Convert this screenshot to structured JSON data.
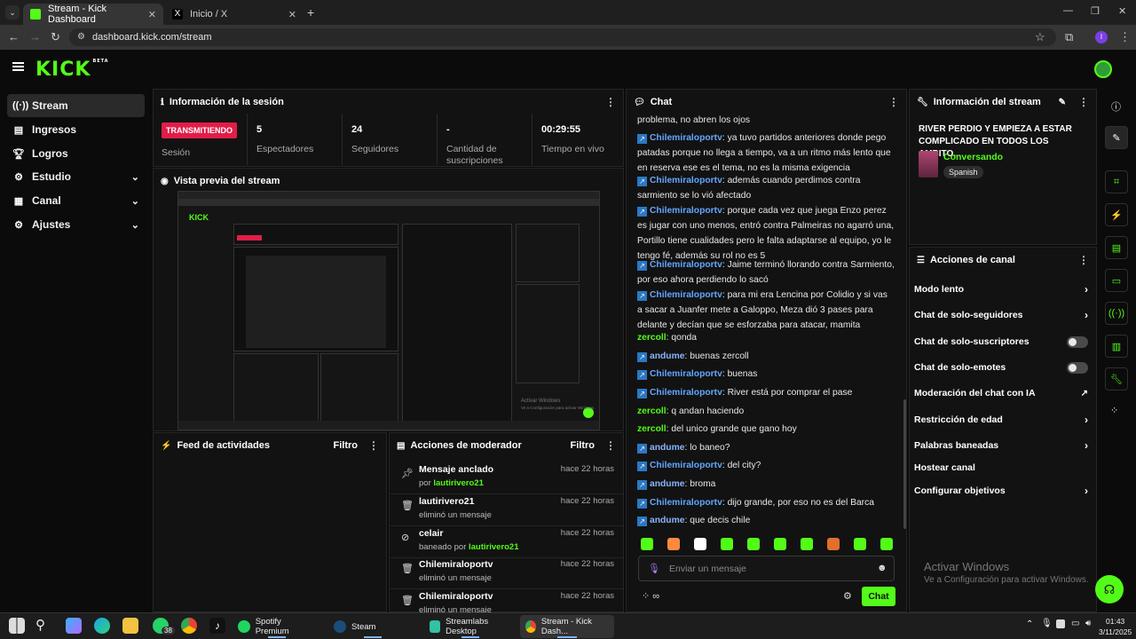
{
  "browser": {
    "tabs": [
      {
        "title": "Stream - Kick Dashboard",
        "active": true
      },
      {
        "title": "Inicio / X",
        "active": false
      }
    ],
    "url": "dashboard.kick.com/stream"
  },
  "logo": "KICK",
  "logo_badge": "BETA",
  "sidebar": {
    "items": [
      {
        "label": "Stream",
        "icon": "broadcast-icon",
        "active": true,
        "expand": false
      },
      {
        "label": "Ingresos",
        "icon": "money-icon",
        "expand": false
      },
      {
        "label": "Logros",
        "icon": "trophy-icon",
        "expand": false
      },
      {
        "label": "Estudio",
        "icon": "studio-icon",
        "expand": true
      },
      {
        "label": "Canal",
        "icon": "channel-icon",
        "expand": true
      },
      {
        "label": "Ajustes",
        "icon": "gear-icon",
        "expand": true
      }
    ]
  },
  "session": {
    "title": "Información de la sesión",
    "status_badge": "TRANSMITIENDO",
    "status_label": "Sesión",
    "stats": [
      {
        "value": "5",
        "label": "Espectadores"
      },
      {
        "value": "24",
        "label": "Seguidores"
      },
      {
        "value": "-",
        "label": "Cantidad de suscripciones"
      },
      {
        "value": "00:29:55",
        "label": "Tiempo en vivo"
      }
    ]
  },
  "preview": {
    "title": "Vista previa del stream",
    "overlay_line1": "Activar Windows",
    "overlay_line2": "Ve a Configuración para activar Windows."
  },
  "activity": {
    "title": "Feed de actividades",
    "filter": "Filtro"
  },
  "modactions": {
    "title": "Acciones de moderador",
    "filter": "Filtro",
    "rows": [
      {
        "icon": "pin-icon",
        "title": "Mensaje anclado",
        "pre": "por ",
        "user": "lautirivero21",
        "sub": "",
        "time": "hace 22 horas"
      },
      {
        "icon": "trash-icon",
        "title": "lautirivero21",
        "pre": "",
        "user": "",
        "sub": "eliminó un mensaje",
        "time": "hace 22 horas"
      },
      {
        "icon": "ban-icon",
        "title": "celair",
        "pre": "baneado por ",
        "user": "lautirivero21",
        "sub": "",
        "time": "hace 22 horas"
      },
      {
        "icon": "trash-icon",
        "title": "Chilemiraloportv",
        "pre": "",
        "user": "",
        "sub": "eliminó un mensaje",
        "time": "hace 22 horas"
      },
      {
        "icon": "trash-icon",
        "title": "Chilemiraloportv",
        "pre": "",
        "user": "",
        "sub": "eliminó un mensaje",
        "time": "hace 22 horas"
      }
    ]
  },
  "chat": {
    "title": "Chat",
    "placeholder": "Enviar un mensaje",
    "send": "Chat",
    "messages": [
      {
        "user": "",
        "badge": false,
        "color": "",
        "text": "problema, no abren los ojos"
      },
      {
        "user": "Chilemiraloportv",
        "badge": true,
        "color": "blue",
        "text": "ya tuvo partidos anteriores donde pego patadas porque no llega a tiempo, va a un ritmo más lento que en reserva ese es el tema, no es la misma exigencia"
      },
      {
        "user": "Chilemiraloportv",
        "badge": true,
        "color": "blue",
        "text": "además cuando perdimos contra sarmiento se lo vió afectado"
      },
      {
        "user": "Chilemiraloportv",
        "badge": true,
        "color": "blue",
        "text": "porque cada vez que juega Enzo perez es jugar con uno menos, entró contra Palmeiras no agarró una, Portillo tiene cualidades pero le falta adaptarse al equipo, yo le tengo fé, además su rol no es 5"
      },
      {
        "user": "Chilemiraloportv",
        "badge": true,
        "color": "blue",
        "text": "Jaime terminó llorando contra Sarmiento, por eso ahora perdiendo lo sacó"
      },
      {
        "user": "Chilemiraloportv",
        "badge": true,
        "color": "blue",
        "text": "para mi era Lencina por Colidio y si vas a sacar a Juanfer mete a Galoppo, Meza dió 3 pases para delante y decían que se esforzaba para atacar, mamita"
      },
      {
        "user": "zercoll",
        "badge": false,
        "color": "green",
        "text": "qonda"
      },
      {
        "user": "andume",
        "badge": true,
        "color": "lblue",
        "text": "buenas zercoll"
      },
      {
        "user": "Chilemiraloportv",
        "badge": true,
        "color": "blue",
        "text": "buenas"
      },
      {
        "user": "Chilemiraloportv",
        "badge": true,
        "color": "blue",
        "text": "River está por comprar el pase"
      },
      {
        "user": "zercoll",
        "badge": false,
        "color": "green",
        "text": "q andan haciendo"
      },
      {
        "user": "zercoll",
        "badge": false,
        "color": "green",
        "text": "del unico grande que gano hoy"
      },
      {
        "user": "andume",
        "badge": true,
        "color": "lblue",
        "text": "lo baneo?"
      },
      {
        "user": "Chilemiraloportv",
        "badge": true,
        "color": "blue",
        "text": "del city?"
      },
      {
        "user": "andume",
        "badge": true,
        "color": "lblue",
        "text": "broma"
      },
      {
        "user": "Chilemiraloportv",
        "badge": true,
        "color": "blue",
        "text": "dijo grande, por eso no es del Barca"
      },
      {
        "user": "andume",
        "badge": true,
        "color": "lblue",
        "text": "que decis chile"
      }
    ]
  },
  "streaminfo": {
    "title": "Información del stream",
    "stream_title": "RIVER PERDIO Y EMPIEZA A ESTAR COMPLICADO EN TODOS LOS AMBITO...",
    "category": "Conversando",
    "language": "Spanish"
  },
  "channelactions": {
    "title": "Acciones de canal",
    "items": [
      {
        "label": "Modo lento",
        "kind": "chevron"
      },
      {
        "label": "Chat de solo-seguidores",
        "kind": "chevron"
      },
      {
        "label": "Chat de solo-suscriptores",
        "kind": "toggle"
      },
      {
        "label": "Chat de solo-emotes",
        "kind": "toggle"
      },
      {
        "label": "Moderación del chat con IA",
        "kind": "external"
      },
      {
        "label": "Restricción de edad",
        "kind": "chevron"
      },
      {
        "label": "Palabras baneadas",
        "kind": "chevron"
      },
      {
        "label": "Hostear canal",
        "kind": "none"
      },
      {
        "label": "Configurar objetivos",
        "kind": "chevron"
      }
    ]
  },
  "watermark": {
    "line1": "Activar Windows",
    "line2": "Ve a Configuración para activar Windows."
  },
  "taskbar": {
    "apps": [
      {
        "label": "Spotify Premium"
      },
      {
        "label": "Steam"
      },
      {
        "label": "Streamlabs Desktop"
      },
      {
        "label": "Stream - Kick Dash..."
      }
    ],
    "whatsapp_badge": "38",
    "time": "01:43",
    "date": "3/11/2025"
  },
  "colors": {
    "accent": "#53fc18",
    "live": "#e11d48",
    "link_blue": "#63a6ff"
  }
}
